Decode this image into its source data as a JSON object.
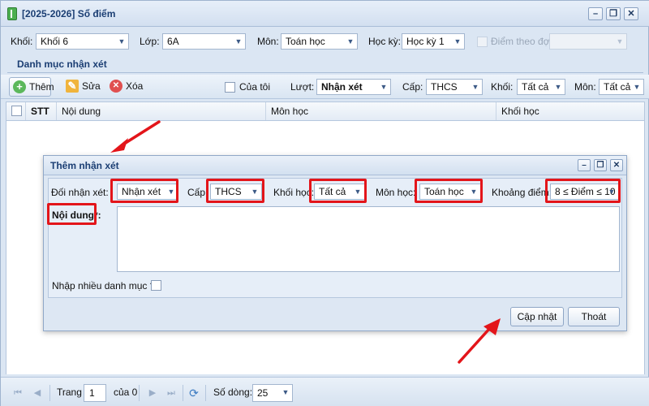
{
  "window": {
    "title": "[2025-2026] Sổ điểm"
  },
  "filters": {
    "khoi_label": "Khối:",
    "khoi_value": "Khối 6",
    "lop_label": "Lớp:",
    "lop_value": "6A",
    "mon_label": "Môn:",
    "mon_value": "Toán học",
    "hocky_label": "Học kỳ:",
    "hocky_value": "Học kỳ 1",
    "diem_theo_dot_label": "Điểm theo đợt"
  },
  "section": {
    "title": "Danh mục nhận xét"
  },
  "toolbar": {
    "add_label": "Thêm",
    "edit_label": "Sửa",
    "delete_label": "Xóa",
    "cua_toi_label": "Của tôi",
    "luot_label": "Lượt:",
    "luot_value": "Nhận xét",
    "cap_label": "Cấp:",
    "cap_value": "THCS",
    "khoi_label": "Khối:",
    "khoi_value": "Tất cả",
    "mon_label": "Môn:",
    "mon_value": "Tất cả"
  },
  "grid": {
    "columns": [
      "STT",
      "Nội dung",
      "Môn học",
      "Khối học"
    ]
  },
  "pager": {
    "trang_label": "Trang",
    "page_value": "1",
    "of_label": "của 0",
    "so_dong_label": "Số dòng:",
    "so_dong_value": "25"
  },
  "dialog": {
    "title": "Thêm nhận xét",
    "doi_nhan_xet_label": "Đối nhận xét:",
    "doi_nhan_xet_value": "Nhận xét",
    "cap_label": "Cấp:",
    "cap_value": "THCS",
    "khoi_hoc_label": "Khối học:",
    "khoi_hoc_value": "Tất cả",
    "mon_hoc_label": "Môn học:",
    "mon_hoc_value": "Toán học",
    "khoang_diem_label": "Khoảng điểm:",
    "khoang_diem_value": "8 ≤ Điểm ≤ 10",
    "noi_dung_label": "Nội dung*:",
    "nhap_nhieu_label": "Nhập nhiều danh mục ?:",
    "update_label": "Cập nhật",
    "exit_label": "Thoát"
  },
  "colors": {
    "highlight": "#e3151a",
    "title_text": "#1b3e73",
    "panel": "#dbe6f3"
  },
  "icons": [
    "app-book-icon",
    "minimize-icon",
    "restore-icon",
    "close-icon",
    "add-icon",
    "edit-icon",
    "delete-icon",
    "refresh-icon",
    "first-page-icon",
    "prev-page-icon",
    "next-page-icon",
    "last-page-icon",
    "dropdown-arrow-icon"
  ]
}
